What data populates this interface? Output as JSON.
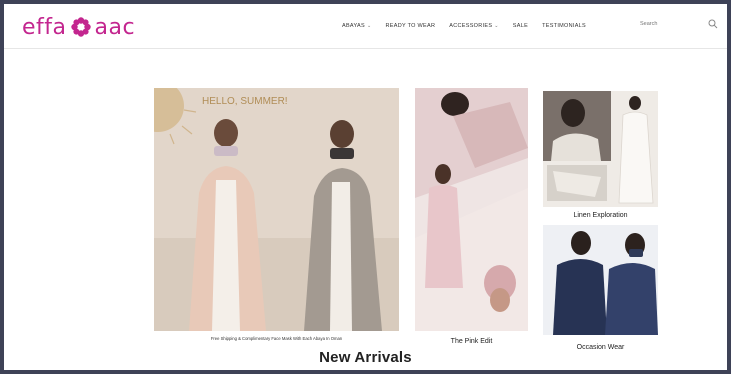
{
  "brand": {
    "name_left": "effa",
    "name_right": "aac"
  },
  "nav": {
    "items": [
      {
        "label": "ABAYAS",
        "has_dropdown": true
      },
      {
        "label": "READY TO WEAR",
        "has_dropdown": false
      },
      {
        "label": "ACCESSORIES",
        "has_dropdown": true
      },
      {
        "label": "SALE",
        "has_dropdown": false
      },
      {
        "label": "TESTIMONIALS",
        "has_dropdown": false
      }
    ],
    "caret": "⌄"
  },
  "search": {
    "placeholder": "Search"
  },
  "hero": {
    "banner_title": "HELLO, SUMMER!",
    "caption": "Free Shipping & Complimentary Face Mask With Each Abaya In Oman"
  },
  "collections": [
    {
      "label": "The Pink Edit"
    },
    {
      "label": "Linen Exploration"
    },
    {
      "label": "Occasion Wear"
    }
  ],
  "section_title": "New Arrivals",
  "colors": {
    "brand": "#c3268f",
    "outer_bg": "#3e4257"
  }
}
